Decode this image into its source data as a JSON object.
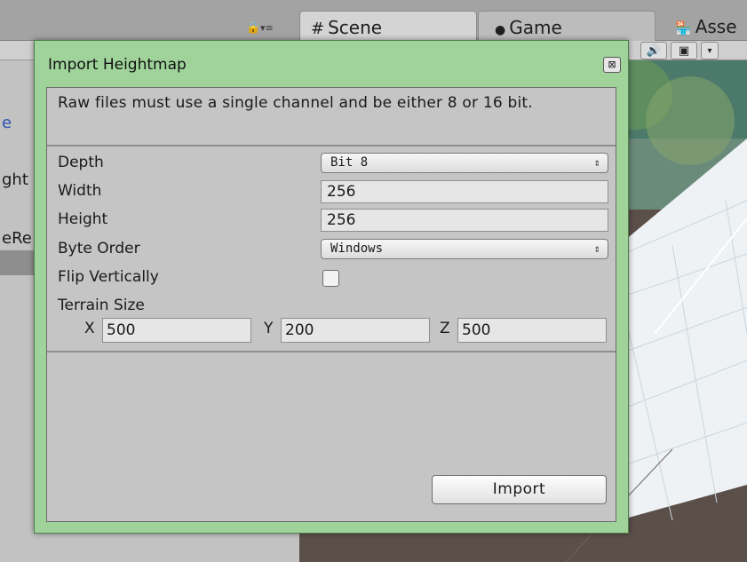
{
  "editor": {
    "tabs": [
      {
        "label": "Scene",
        "icon": "grid-icon"
      },
      {
        "label": "Game",
        "icon": "pacman-icon"
      },
      {
        "label": "Asse",
        "icon": "store-icon"
      }
    ],
    "left_fragments": [
      "e",
      "ght",
      "eRe"
    ]
  },
  "dialog": {
    "title": "Import Heightmap",
    "info": "Raw files must use a single channel and be either 8 or 16 bit.",
    "fields": {
      "depth": {
        "label": "Depth",
        "value": "Bit 8"
      },
      "width": {
        "label": "Width",
        "value": "256"
      },
      "height": {
        "label": "Height",
        "value": "256"
      },
      "byte_order": {
        "label": "Byte Order",
        "value": "Windows"
      },
      "flip_vertically": {
        "label": "Flip Vertically",
        "checked": false
      }
    },
    "terrain_size": {
      "label": "Terrain Size",
      "x_label": "X",
      "x": "500",
      "y_label": "Y",
      "y": "200",
      "z_label": "Z",
      "z": "500"
    },
    "import_button": "Import"
  },
  "colors": {
    "dialog_frame": "#9fd39a",
    "dialog_body": "#c5c5c5",
    "scene_tile": "#eef2f4",
    "ground": "#5b4f4a"
  }
}
